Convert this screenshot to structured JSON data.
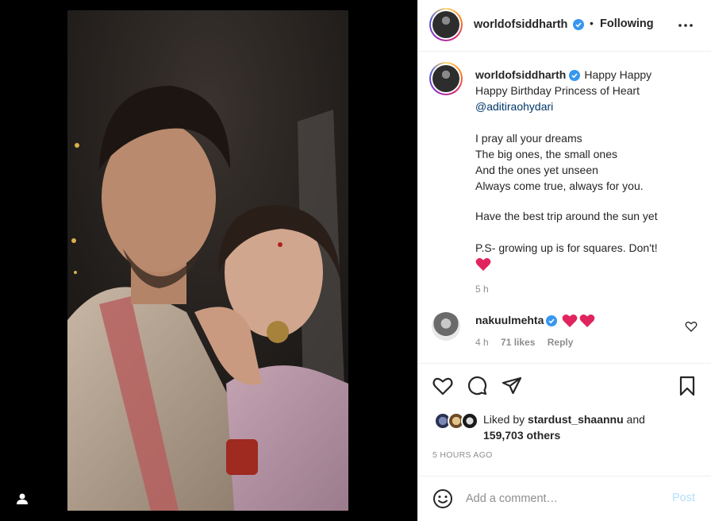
{
  "post": {
    "username": "worldofsiddharth",
    "follow_status": "Following",
    "dot": "•"
  },
  "caption": {
    "username": "worldofsiddharth",
    "line1": "Happy Happy",
    "line2": "Happy Birthday Princess of Heart",
    "mention": "@aditiraohydari",
    "line3": "I pray all your dreams",
    "line4": "The big ones, the small ones",
    "line5": "And the ones yet unseen",
    "line6": "Always come true, always for you.",
    "line7": "Have the best trip around the sun yet",
    "line8": "P.S- growing up is for squares. Don't!",
    "time": "5 h"
  },
  "comment": {
    "username": "nakuulmehta",
    "time": "4 h",
    "likes": "71 likes",
    "reply": "Reply"
  },
  "likes": {
    "prefix": "Liked by",
    "liker": "stardust_shaannu",
    "suffix": "and",
    "count": "159,703 others"
  },
  "timestamp": "5 HOURS AGO",
  "add_comment": {
    "placeholder": "Add a comment…",
    "post_label": "Post"
  },
  "colors": {
    "verified": "#3897f0",
    "heart": "#ed4956",
    "link": "#00376b",
    "post_disabled": "#b2dffc"
  },
  "icons": [
    "user-tag-icon",
    "more-icon",
    "heart-icon",
    "comment-icon",
    "share-icon",
    "bookmark-icon",
    "smile-icon",
    "verified-icon"
  ]
}
